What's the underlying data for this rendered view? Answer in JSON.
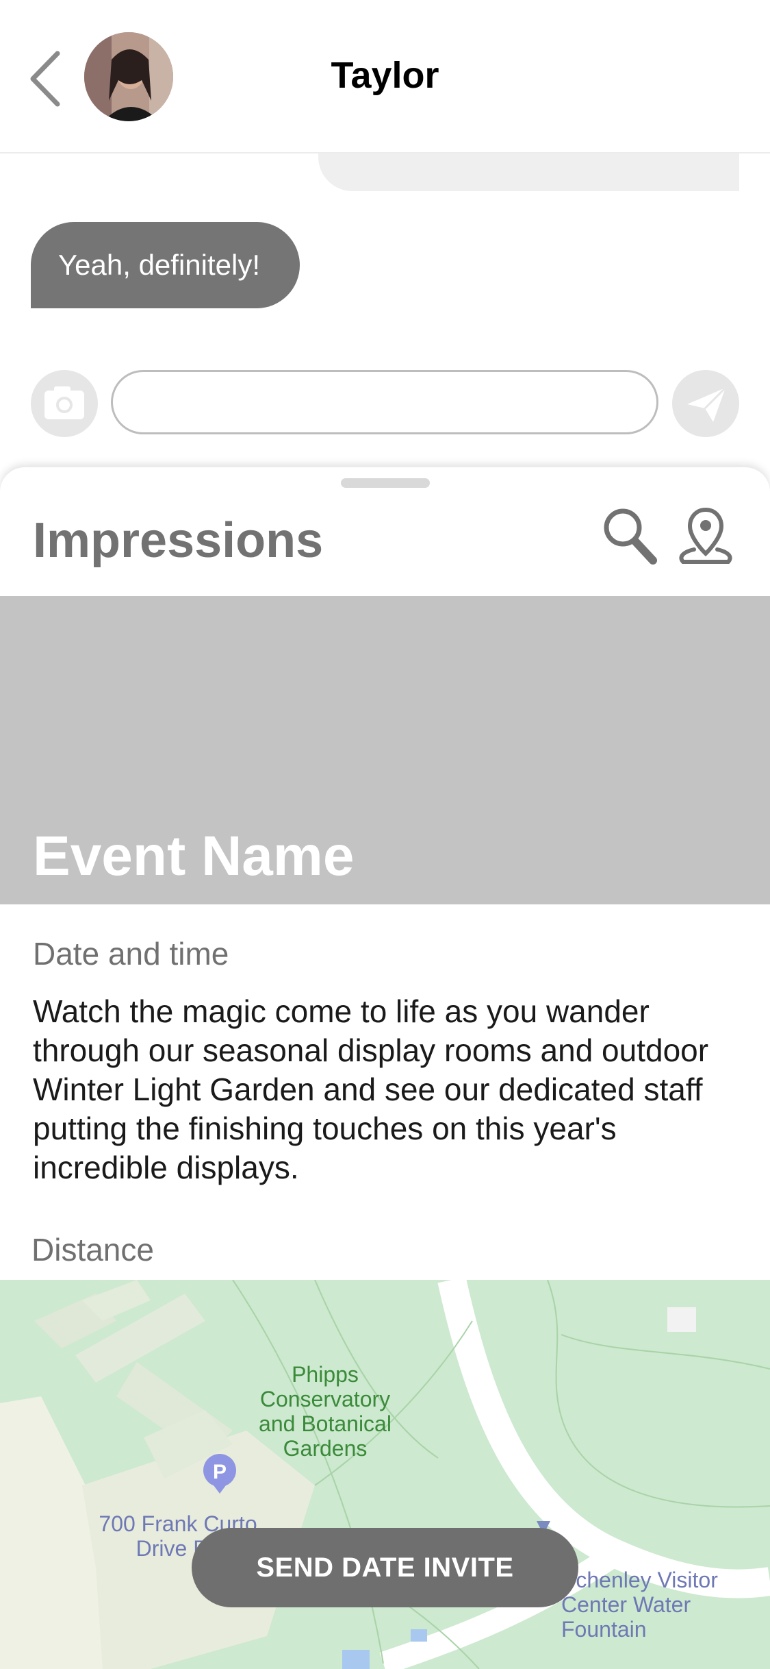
{
  "header": {
    "contact_name": "Taylor"
  },
  "chat": {
    "received_message": "Yeah, definitely!",
    "input_placeholder": ""
  },
  "sheet": {
    "title": "Impressions",
    "event": {
      "name": "Event Name",
      "date_time_label": "Date and time",
      "description": "Watch the magic come to life as you wander through our seasonal display rooms and outdoor Winter Light Garden and see our dedicated staff putting the finishing touches on this year's incredible displays.",
      "distance_label": "Distance"
    },
    "map": {
      "poi_name": "Phipps Conservatory and Botanical Gardens",
      "parking_label": "700 Frank Curto Drive Pa",
      "visitor_center_label": "Schenley Visitor Center Water Fountain",
      "parking_icon_text": "P"
    },
    "invite_button": "SEND DATE INVITE"
  },
  "colors": {
    "bubble_in": "#757575",
    "bubble_out": "#efefef",
    "banner": "#c3c3c3",
    "button": "#6f6f6f",
    "map_green": "#cde9cf"
  }
}
